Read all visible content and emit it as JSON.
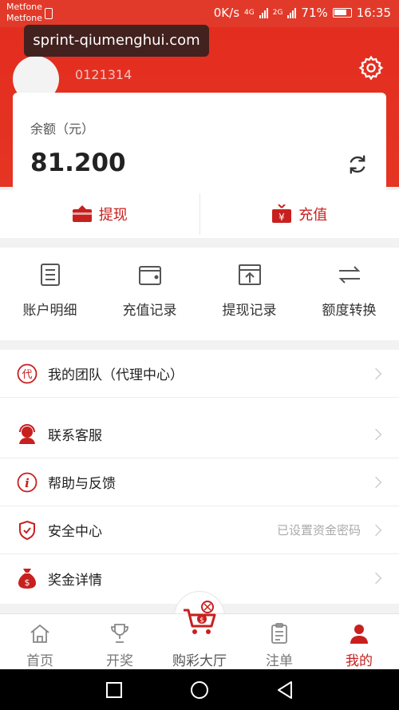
{
  "statusbar": {
    "carrier_1": "Metfone",
    "carrier_2": "Metfone",
    "speed": "0K/s",
    "net_1": "4G",
    "net_2": "2G",
    "battery": "71%",
    "time": "16:35"
  },
  "header": {
    "username": "0121314",
    "watermark": "sprint-qiumenghui.com"
  },
  "balance": {
    "label": "余额（元）",
    "value": "81.200"
  },
  "actions": {
    "withdraw": "提现",
    "recharge": "充值"
  },
  "quick_links": [
    {
      "label": "账户明细",
      "icon": "document-list-icon"
    },
    {
      "label": "充值记录",
      "icon": "wallet-icon"
    },
    {
      "label": "提现记录",
      "icon": "withdraw-record-icon"
    },
    {
      "label": "额度转换",
      "icon": "transfer-arrows-icon"
    }
  ],
  "menu": [
    {
      "label": "我的团队（代理中心）",
      "icon": "agent-icon",
      "hint": ""
    },
    {
      "label": "联系客服",
      "icon": "customer-service-icon",
      "hint": ""
    },
    {
      "label": "帮助与反馈",
      "icon": "info-icon",
      "hint": ""
    },
    {
      "label": "安全中心",
      "icon": "shield-icon",
      "hint": "已设置资金密码"
    },
    {
      "label": "奖金详情",
      "icon": "money-bag-icon",
      "hint": ""
    }
  ],
  "tabs": [
    {
      "label": "首页",
      "icon": "home-icon"
    },
    {
      "label": "开奖",
      "icon": "trophy-icon"
    },
    {
      "label": "购彩大厅",
      "icon": "cart-icon"
    },
    {
      "label": "注单",
      "icon": "clipboard-icon"
    },
    {
      "label": "我的",
      "icon": "user-icon"
    }
  ],
  "colors": {
    "brand_red": "#e32d1f",
    "accent_red": "#c8201f"
  }
}
